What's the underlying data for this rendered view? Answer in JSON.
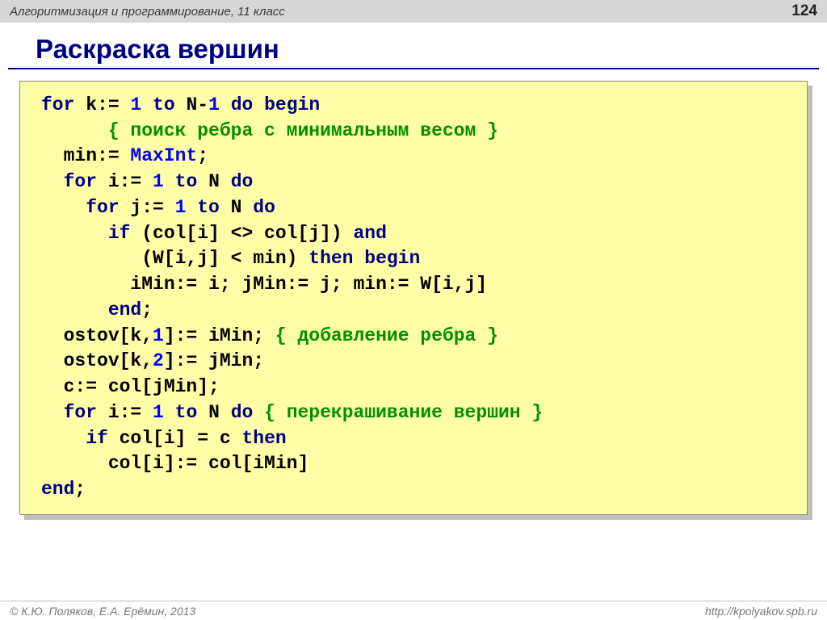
{
  "header": {
    "subject": "Алгоритмизация и программирование, 11 класс",
    "page": "124"
  },
  "title": "Раскраска вершин",
  "code": {
    "l1_a": "for",
    "l1_b": " k:= ",
    "l1_c": "1",
    "l1_d": " to",
    "l1_e": " N-",
    "l1_f": "1",
    "l1_g": " do begin",
    "l2_a": "      { поиск ребра с минимальным весом }",
    "l3_a": "  min:= ",
    "l3_b": "MaxInt",
    "l3_c": ";",
    "l4_a": "  for",
    "l4_b": " i:= ",
    "l4_c": "1",
    "l4_d": " to",
    "l4_e": " N ",
    "l4_f": "do",
    "l5_a": "    for",
    "l5_b": " j:= ",
    "l5_c": "1",
    "l5_d": " to",
    "l5_e": " N ",
    "l5_f": "do",
    "l6_a": "      if",
    "l6_b": " (col[i] <> col[j]) ",
    "l6_c": "and",
    "l7_a": "         (W[i,j] < min) ",
    "l7_b": "then begin",
    "l8_a": "        iMin:= i; jMin:= j; min:= W[i,j]",
    "l9_a": "      end",
    "l9_b": ";",
    "l10_a": "  ostov[k,",
    "l10_b": "1",
    "l10_c": "]:= iMin; ",
    "l10_d": "{ добавление ребра }",
    "l11_a": "  ostov[k,",
    "l11_b": "2",
    "l11_c": "]:= jMin;",
    "l12_a": "  c:= col[jMin];",
    "l13_a": "  for",
    "l13_b": " i:= ",
    "l13_c": "1",
    "l13_d": " to",
    "l13_e": " N ",
    "l13_f": "do",
    "l13_g": " { перекрашивание вершин }",
    "l14_a": "    if",
    "l14_b": " col[i] = c ",
    "l14_c": "then",
    "l15_a": "      col[i]:= col[iMin]",
    "l16_a": "end",
    "l16_b": ";"
  },
  "footer": {
    "left": "© К.Ю. Поляков, Е.А. Ерёмин, 2013",
    "right": "http://kpolyakov.spb.ru"
  }
}
